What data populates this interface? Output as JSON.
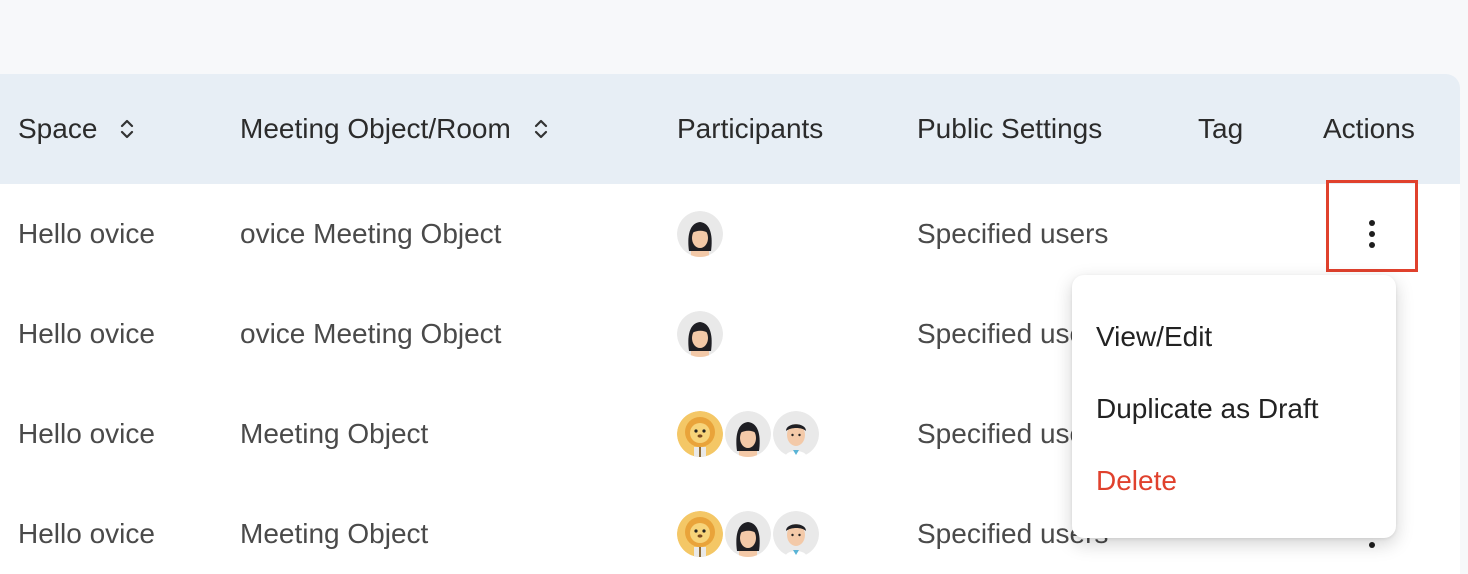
{
  "table": {
    "columns": [
      {
        "label": "Space",
        "sortable": true
      },
      {
        "label": "Meeting Object/Room",
        "sortable": true
      },
      {
        "label": "Participants",
        "sortable": false
      },
      {
        "label": "Public Settings",
        "sortable": false
      },
      {
        "label": "Tag",
        "sortable": false
      },
      {
        "label": "Actions",
        "sortable": false
      }
    ],
    "rows": [
      {
        "space": "Hello ovice",
        "room": "ovice Meeting Object",
        "participants": [
          "woman-avatar"
        ],
        "public_settings": "Specified users",
        "tag": ""
      },
      {
        "space": "Hello ovice",
        "room": "ovice Meeting Object",
        "participants": [
          "woman-avatar"
        ],
        "public_settings": "Specified users",
        "tag": ""
      },
      {
        "space": "Hello ovice",
        "room": "Meeting Object",
        "participants": [
          "lion-avatar",
          "woman-avatar",
          "man-avatar"
        ],
        "public_settings": "Specified users",
        "tag": ""
      },
      {
        "space": "Hello ovice",
        "room": "Meeting Object",
        "participants": [
          "lion-avatar",
          "woman-avatar",
          "man-avatar"
        ],
        "public_settings": "Specified users",
        "tag": ""
      }
    ]
  },
  "actions_menu": {
    "items": [
      {
        "label": "View/Edit"
      },
      {
        "label": "Duplicate as Draft"
      },
      {
        "label": "Delete"
      }
    ]
  },
  "colors": {
    "header_bg": "#e7eef5",
    "highlight": "#e0412d",
    "delete": "#e0412d"
  }
}
